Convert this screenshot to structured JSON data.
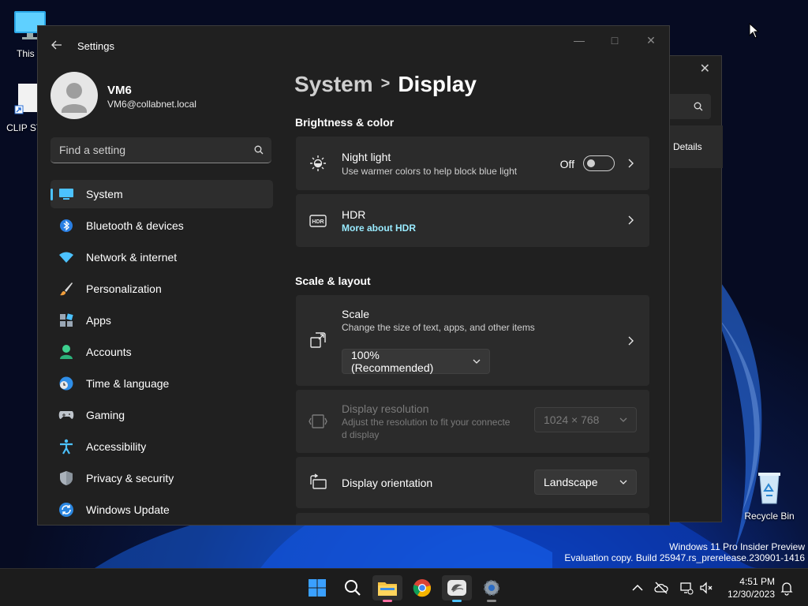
{
  "desktop": {
    "icons": [
      {
        "label": "This P",
        "icon": "monitor-icon"
      },
      {
        "label": "CLIP STU",
        "icon": "shortcut-file-icon"
      },
      {
        "label": "Recycle Bin",
        "icon": "recycle-bin-icon"
      }
    ],
    "watermark_line1": "Windows 11 Pro Insider Preview",
    "watermark_line2": "Evaluation copy. Build 25947.rs_prerelease.230901-1416"
  },
  "background_window": {
    "details_label": "Details"
  },
  "settings": {
    "title": "Settings",
    "user": {
      "name": "VM6",
      "email": "VM6@collabnet.local"
    },
    "search_placeholder": "Find a setting",
    "nav": [
      {
        "label": "System",
        "icon": "system-monitor-icon",
        "selected": true
      },
      {
        "label": "Bluetooth & devices",
        "icon": "bluetooth-icon"
      },
      {
        "label": "Network & internet",
        "icon": "wifi-icon"
      },
      {
        "label": "Personalization",
        "icon": "paintbrush-icon"
      },
      {
        "label": "Apps",
        "icon": "apps-icon"
      },
      {
        "label": "Accounts",
        "icon": "person-icon"
      },
      {
        "label": "Time & language",
        "icon": "globe-clock-icon"
      },
      {
        "label": "Gaming",
        "icon": "gamepad-icon"
      },
      {
        "label": "Accessibility",
        "icon": "accessibility-icon"
      },
      {
        "label": "Privacy & security",
        "icon": "shield-icon"
      },
      {
        "label": "Windows Update",
        "icon": "update-icon"
      }
    ],
    "breadcrumb": {
      "parent": "System",
      "separator": ">",
      "current": "Display"
    },
    "sections": {
      "brightness": "Brightness & color",
      "scale_layout": "Scale & layout"
    },
    "night_light": {
      "title": "Night light",
      "subtitle": "Use warmer colors to help block blue light",
      "state": "Off"
    },
    "hdr": {
      "title": "HDR",
      "link": "More about HDR"
    },
    "scale": {
      "title": "Scale",
      "subtitle": "Change the size of text, apps, and other items",
      "value": "100% (Recommended)"
    },
    "resolution": {
      "title": "Display resolution",
      "subtitle_line1": "Adjust the resolution to fit your connecte",
      "subtitle_line2": "d display",
      "value": "1024 × 768"
    },
    "orientation": {
      "title": "Display orientation",
      "value": "Landscape"
    }
  },
  "taskbar": {
    "apps": [
      "start-icon",
      "search-icon",
      "file-explorer-icon",
      "chrome-icon",
      "snipping-app-icon",
      "settings-gear-icon"
    ],
    "time": "4:51 PM",
    "date": "12/30/2023"
  },
  "colors": {
    "accent": "#4cc2ff",
    "link": "#99ebff",
    "window_bg": "#202020",
    "card_bg": "#2b2b2b"
  }
}
